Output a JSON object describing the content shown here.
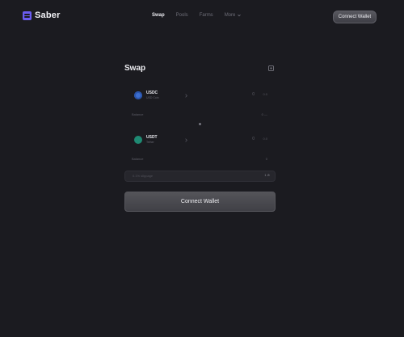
{
  "header": {
    "logo_text": "Saber",
    "nav": [
      {
        "label": "Swap",
        "active": true
      },
      {
        "label": "Pools",
        "active": false
      },
      {
        "label": "Farms",
        "active": false
      }
    ],
    "more_label": "More",
    "connect_label": "Connect Wallet"
  },
  "swap": {
    "title": "Swap",
    "from": {
      "symbol": "USDC",
      "name": "USD Coin",
      "amount": "0",
      "max_label": "0.0",
      "balance_label": "Balance",
      "balance_value": "0 —"
    },
    "to": {
      "symbol": "USDT",
      "name": "Tether",
      "amount": "0",
      "max_label": "0.0",
      "balance_label": "Balance",
      "balance_value": "0"
    },
    "slippage_placeholder": "0.1% slippage",
    "slippage_value": "1 ⊘",
    "connect_label": "Connect Wallet"
  },
  "colors": {
    "background": "#1b1b20",
    "accent": "#6a5cf0",
    "usdc": "#3d6fd0",
    "usdt": "#1f8a73"
  },
  "icons": {
    "logo": "saber-logo-icon",
    "more": "chevron-down-icon",
    "settings": "gear-icon",
    "token_select": "chevron-right-icon",
    "switch": "swap-direction-icon"
  }
}
